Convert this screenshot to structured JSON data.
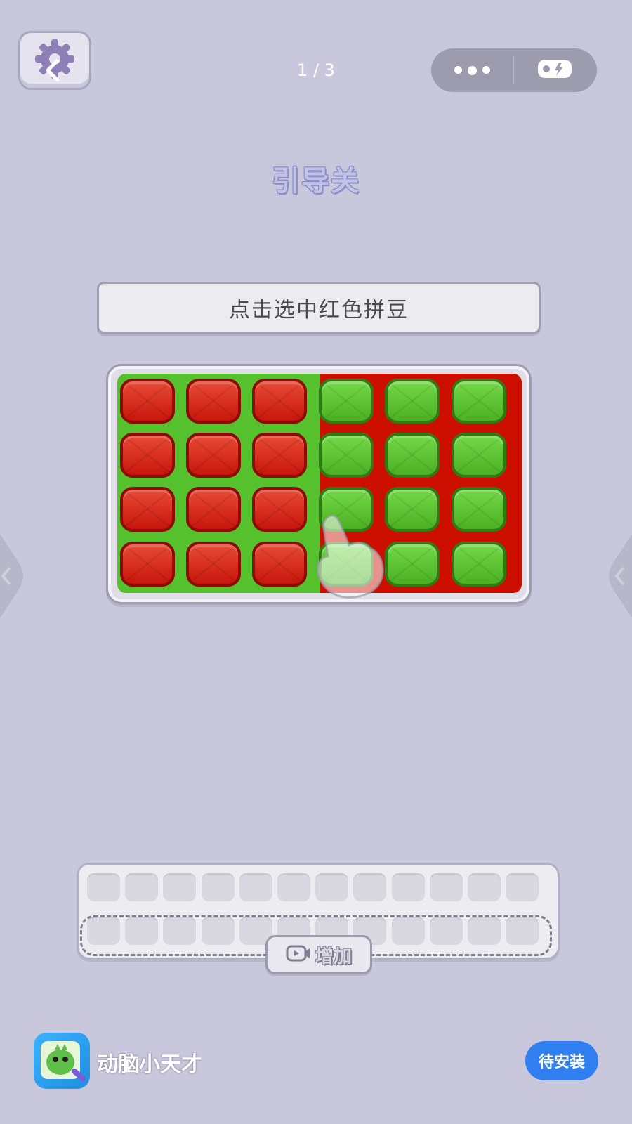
{
  "header": {
    "page_indicator": "1 / 3",
    "back_icon": "chevron-left-icon",
    "settings_icon": "gear-icon",
    "capsule": {
      "more_icon": "more-dots-icon",
      "game_icon": "gamepad-icon"
    }
  },
  "level": {
    "title": "引导关"
  },
  "instruction": {
    "text": "点击选中红色拼豆"
  },
  "board": {
    "left_background": "#55c12c",
    "right_background": "#cc0f00",
    "rows": [
      [
        "red",
        "red",
        "red",
        "green",
        "green",
        "green"
      ],
      [
        "red",
        "red",
        "red",
        "green",
        "green",
        "green"
      ],
      [
        "red",
        "red",
        "red",
        "green",
        "green",
        "green"
      ],
      [
        "red",
        "red",
        "red",
        "green",
        "green",
        "green"
      ]
    ]
  },
  "tray": {
    "slots_per_row": 12,
    "rows": 2,
    "add_button_label": "增加",
    "add_button_icon": "video-icon"
  },
  "ad": {
    "app_name": "动脑小天才",
    "install_label": "待安装",
    "install_color": "#2f7ff0"
  }
}
